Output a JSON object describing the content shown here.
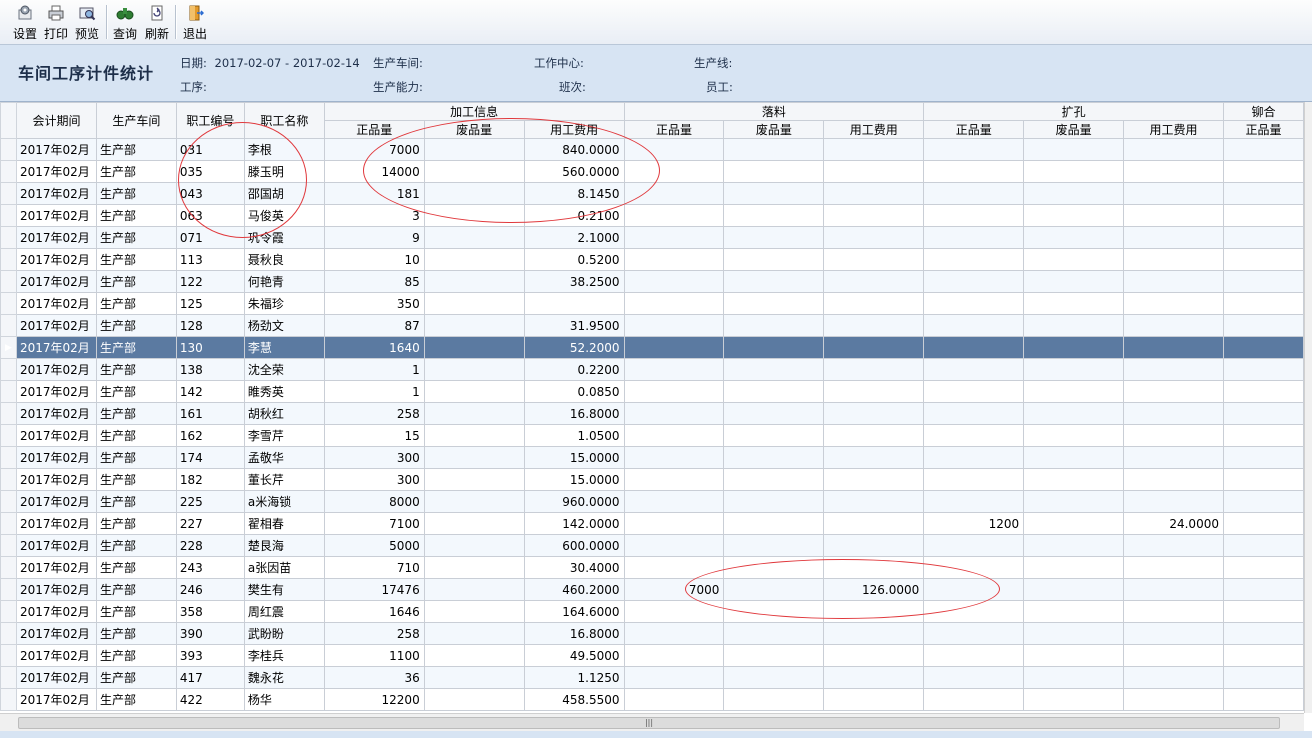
{
  "toolbar": {
    "buttons": [
      {
        "label": "设置",
        "icon": "settings-icon"
      },
      {
        "label": "打印",
        "icon": "printer-icon"
      },
      {
        "label": "预览",
        "icon": "preview-icon"
      },
      {
        "label": "查询",
        "icon": "binoculars-icon"
      },
      {
        "label": "刷新",
        "icon": "refresh-icon"
      },
      {
        "label": "退出",
        "icon": "exit-door-icon"
      }
    ]
  },
  "header": {
    "title": "车间工序计件统计",
    "date_label": "日期:",
    "date_value": "2017-02-07 - 2017-02-14",
    "workshop_label": "生产车间:",
    "workcenter_label": "工作中心:",
    "line_label": "生产线:",
    "process_label": "工序:",
    "capacity_label": "生产能力:",
    "shift_label": "班次:",
    "employee_label": "员工:"
  },
  "columns": {
    "period": "会计期间",
    "workshop": "生产车间",
    "emp_no": "职工编号",
    "emp_name": "职工名称",
    "groups": [
      "加工信息",
      "落料",
      "扩孔",
      "铆合"
    ],
    "sub": [
      "正品量",
      "废品量",
      "用工费用"
    ],
    "last_partial": "正品量"
  },
  "rows": [
    {
      "period": "2017年02月",
      "ws": "生产部",
      "no": "031",
      "name": "李根",
      "g": "7000",
      "s": "",
      "c": "840.0000",
      "lg": "",
      "lc": "",
      "kg": "",
      "kc": ""
    },
    {
      "period": "2017年02月",
      "ws": "生产部",
      "no": "035",
      "name": "滕玉明",
      "g": "14000",
      "s": "",
      "c": "560.0000",
      "lg": "",
      "lc": "",
      "kg": "",
      "kc": ""
    },
    {
      "period": "2017年02月",
      "ws": "生产部",
      "no": "043",
      "name": "邵国胡",
      "g": "181",
      "s": "",
      "c": "8.1450",
      "lg": "",
      "lc": "",
      "kg": "",
      "kc": ""
    },
    {
      "period": "2017年02月",
      "ws": "生产部",
      "no": "063",
      "name": "马俊英",
      "g": "3",
      "s": "",
      "c": "0.2100",
      "lg": "",
      "lc": "",
      "kg": "",
      "kc": ""
    },
    {
      "period": "2017年02月",
      "ws": "生产部",
      "no": "071",
      "name": "巩令霞",
      "g": "9",
      "s": "",
      "c": "2.1000",
      "lg": "",
      "lc": "",
      "kg": "",
      "kc": ""
    },
    {
      "period": "2017年02月",
      "ws": "生产部",
      "no": "113",
      "name": "聂秋良",
      "g": "10",
      "s": "",
      "c": "0.5200",
      "lg": "",
      "lc": "",
      "kg": "",
      "kc": ""
    },
    {
      "period": "2017年02月",
      "ws": "生产部",
      "no": "122",
      "name": "何艳青",
      "g": "85",
      "s": "",
      "c": "38.2500",
      "lg": "",
      "lc": "",
      "kg": "",
      "kc": ""
    },
    {
      "period": "2017年02月",
      "ws": "生产部",
      "no": "125",
      "name": "朱福珍",
      "g": "350",
      "s": "",
      "c": "",
      "lg": "",
      "lc": "",
      "kg": "",
      "kc": ""
    },
    {
      "period": "2017年02月",
      "ws": "生产部",
      "no": "128",
      "name": "杨劲文",
      "g": "87",
      "s": "",
      "c": "31.9500",
      "lg": "",
      "lc": "",
      "kg": "",
      "kc": ""
    },
    {
      "period": "2017年02月",
      "ws": "生产部",
      "no": "130",
      "name": "李慧",
      "g": "1640",
      "s": "",
      "c": "52.2000",
      "lg": "",
      "lc": "",
      "kg": "",
      "kc": ""
    },
    {
      "period": "2017年02月",
      "ws": "生产部",
      "no": "138",
      "name": "沈全荣",
      "g": "1",
      "s": "",
      "c": "0.2200",
      "lg": "",
      "lc": "",
      "kg": "",
      "kc": ""
    },
    {
      "period": "2017年02月",
      "ws": "生产部",
      "no": "142",
      "name": "睢秀英",
      "g": "1",
      "s": "",
      "c": "0.0850",
      "lg": "",
      "lc": "",
      "kg": "",
      "kc": ""
    },
    {
      "period": "2017年02月",
      "ws": "生产部",
      "no": "161",
      "name": "胡秋红",
      "g": "258",
      "s": "",
      "c": "16.8000",
      "lg": "",
      "lc": "",
      "kg": "",
      "kc": ""
    },
    {
      "period": "2017年02月",
      "ws": "生产部",
      "no": "162",
      "name": "李雪芹",
      "g": "15",
      "s": "",
      "c": "1.0500",
      "lg": "",
      "lc": "",
      "kg": "",
      "kc": ""
    },
    {
      "period": "2017年02月",
      "ws": "生产部",
      "no": "174",
      "name": "孟敬华",
      "g": "300",
      "s": "",
      "c": "15.0000",
      "lg": "",
      "lc": "",
      "kg": "",
      "kc": ""
    },
    {
      "period": "2017年02月",
      "ws": "生产部",
      "no": "182",
      "name": "董长芹",
      "g": "300",
      "s": "",
      "c": "15.0000",
      "lg": "",
      "lc": "",
      "kg": "",
      "kc": ""
    },
    {
      "period": "2017年02月",
      "ws": "生产部",
      "no": "225",
      "name": "a米海锁",
      "g": "8000",
      "s": "",
      "c": "960.0000",
      "lg": "",
      "lc": "",
      "kg": "",
      "kc": ""
    },
    {
      "period": "2017年02月",
      "ws": "生产部",
      "no": "227",
      "name": "翟相春",
      "g": "7100",
      "s": "",
      "c": "142.0000",
      "lg": "",
      "lc": "",
      "kg": "1200",
      "kc": "24.0000"
    },
    {
      "period": "2017年02月",
      "ws": "生产部",
      "no": "228",
      "name": "楚艮海",
      "g": "5000",
      "s": "",
      "c": "600.0000",
      "lg": "",
      "lc": "",
      "kg": "",
      "kc": ""
    },
    {
      "period": "2017年02月",
      "ws": "生产部",
      "no": "243",
      "name": "a张因苗",
      "g": "710",
      "s": "",
      "c": "30.4000",
      "lg": "",
      "lc": "",
      "kg": "",
      "kc": ""
    },
    {
      "period": "2017年02月",
      "ws": "生产部",
      "no": "246",
      "name": "樊生有",
      "g": "17476",
      "s": "",
      "c": "460.2000",
      "lg": "7000",
      "lc": "126.0000",
      "kg": "",
      "kc": ""
    },
    {
      "period": "2017年02月",
      "ws": "生产部",
      "no": "358",
      "name": "周红震",
      "g": "1646",
      "s": "",
      "c": "164.6000",
      "lg": "",
      "lc": "",
      "kg": "",
      "kc": ""
    },
    {
      "period": "2017年02月",
      "ws": "生产部",
      "no": "390",
      "name": "武盼盼",
      "g": "258",
      "s": "",
      "c": "16.8000",
      "lg": "",
      "lc": "",
      "kg": "",
      "kc": ""
    },
    {
      "period": "2017年02月",
      "ws": "生产部",
      "no": "393",
      "name": "李桂兵",
      "g": "1100",
      "s": "",
      "c": "49.5000",
      "lg": "",
      "lc": "",
      "kg": "",
      "kc": ""
    },
    {
      "period": "2017年02月",
      "ws": "生产部",
      "no": "417",
      "name": "魏永花",
      "g": "36",
      "s": "",
      "c": "1.1250",
      "lg": "",
      "lc": "",
      "kg": "",
      "kc": ""
    },
    {
      "period": "2017年02月",
      "ws": "生产部",
      "no": "422",
      "name": "杨华",
      "g": "12200",
      "s": "",
      "c": "458.5500",
      "lg": "",
      "lc": "",
      "kg": "",
      "kc": ""
    }
  ],
  "selected_row_index": 9,
  "colors": {
    "selected_row": "#5b7aa1",
    "annotation": "#e0383c",
    "header_bg": "#d7e4f3"
  }
}
